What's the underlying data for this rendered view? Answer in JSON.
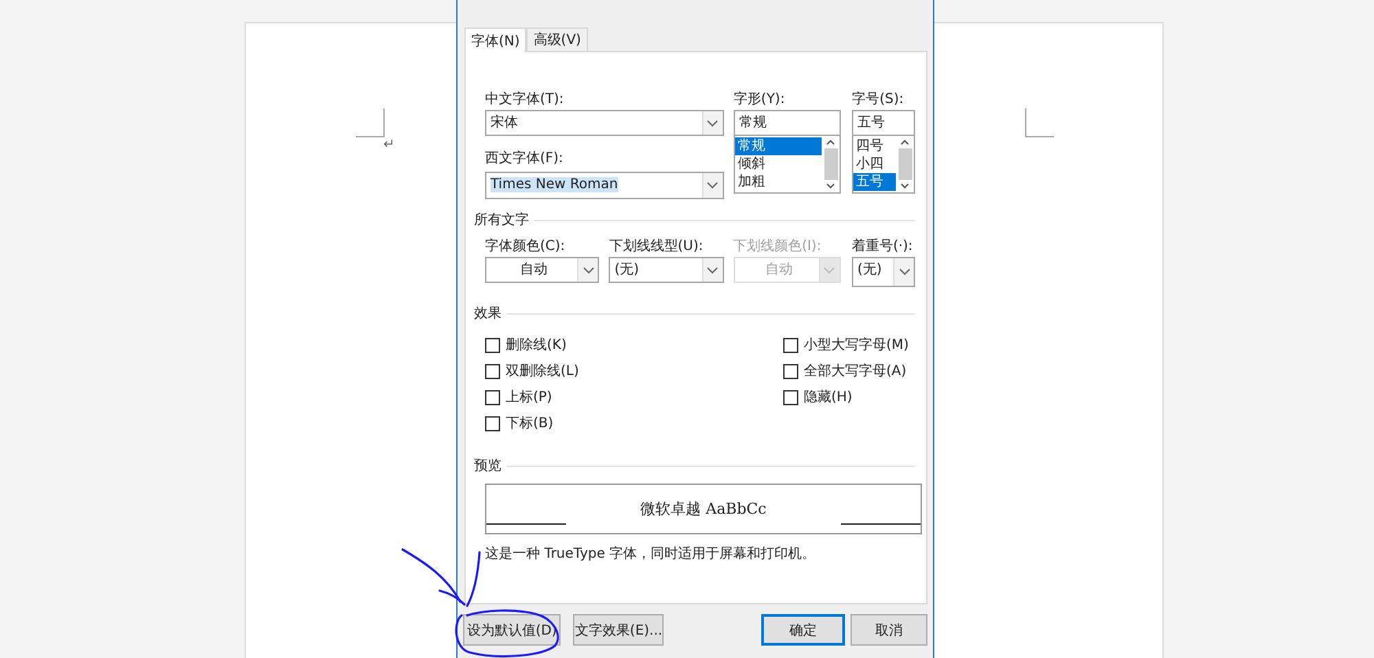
{
  "document": {
    "paragraph_mark": "↵"
  },
  "dialog": {
    "tabs": [
      {
        "label": "字体(N)",
        "selected": true
      },
      {
        "label": "高级(V)",
        "selected": false
      }
    ],
    "chinese_font": {
      "label": "中文字体(T):",
      "value": "宋体"
    },
    "western_font": {
      "label": "西文字体(F):",
      "value": "Times New Roman",
      "selected": true
    },
    "font_style": {
      "label": "字形(Y):",
      "value": "常规",
      "options": [
        {
          "label": "常规",
          "selected": true
        },
        {
          "label": "倾斜",
          "selected": false
        },
        {
          "label": "加粗",
          "selected": false
        }
      ]
    },
    "font_size": {
      "label": "字号(S):",
      "value": "五号",
      "options": [
        {
          "label": "四号",
          "selected": false
        },
        {
          "label": "小四",
          "selected": false
        },
        {
          "label": "五号",
          "selected": true
        }
      ]
    },
    "all_text": {
      "title": "所有文字",
      "fields": [
        {
          "kind": "color",
          "label": "字体颜色(C):",
          "value": "自动",
          "disabled": false
        },
        {
          "kind": "select",
          "label": "下划线线型(U):",
          "value": "(无)",
          "disabled": false
        },
        {
          "kind": "color",
          "label": "下划线颜色(I):",
          "value": "自动",
          "disabled": true
        },
        {
          "kind": "select",
          "label": "着重号(·):",
          "value": "(无)",
          "disabled": false
        }
      ]
    },
    "effects": {
      "title": "效果",
      "left": [
        {
          "label": "删除线(K)",
          "checked": false
        },
        {
          "label": "双删除线(L)",
          "checked": false
        },
        {
          "label": "上标(P)",
          "checked": false
        },
        {
          "label": "下标(B)",
          "checked": false
        }
      ],
      "right": [
        {
          "label": "小型大写字母(M)",
          "checked": false
        },
        {
          "label": "全部大写字母(A)",
          "checked": false
        },
        {
          "label": "隐藏(H)",
          "checked": false
        }
      ]
    },
    "preview": {
      "title": "预览",
      "sample": "微软卓越  AaBbCc",
      "note": "这是一种 TrueType 字体，同时适用于屏幕和打印机。"
    },
    "buttons": [
      {
        "label": "设为默认值(D)",
        "default": false
      },
      {
        "label": "文字效果(E)...",
        "default": false
      },
      {
        "label": "确定",
        "default": true
      },
      {
        "label": "取消",
        "default": false
      }
    ]
  }
}
